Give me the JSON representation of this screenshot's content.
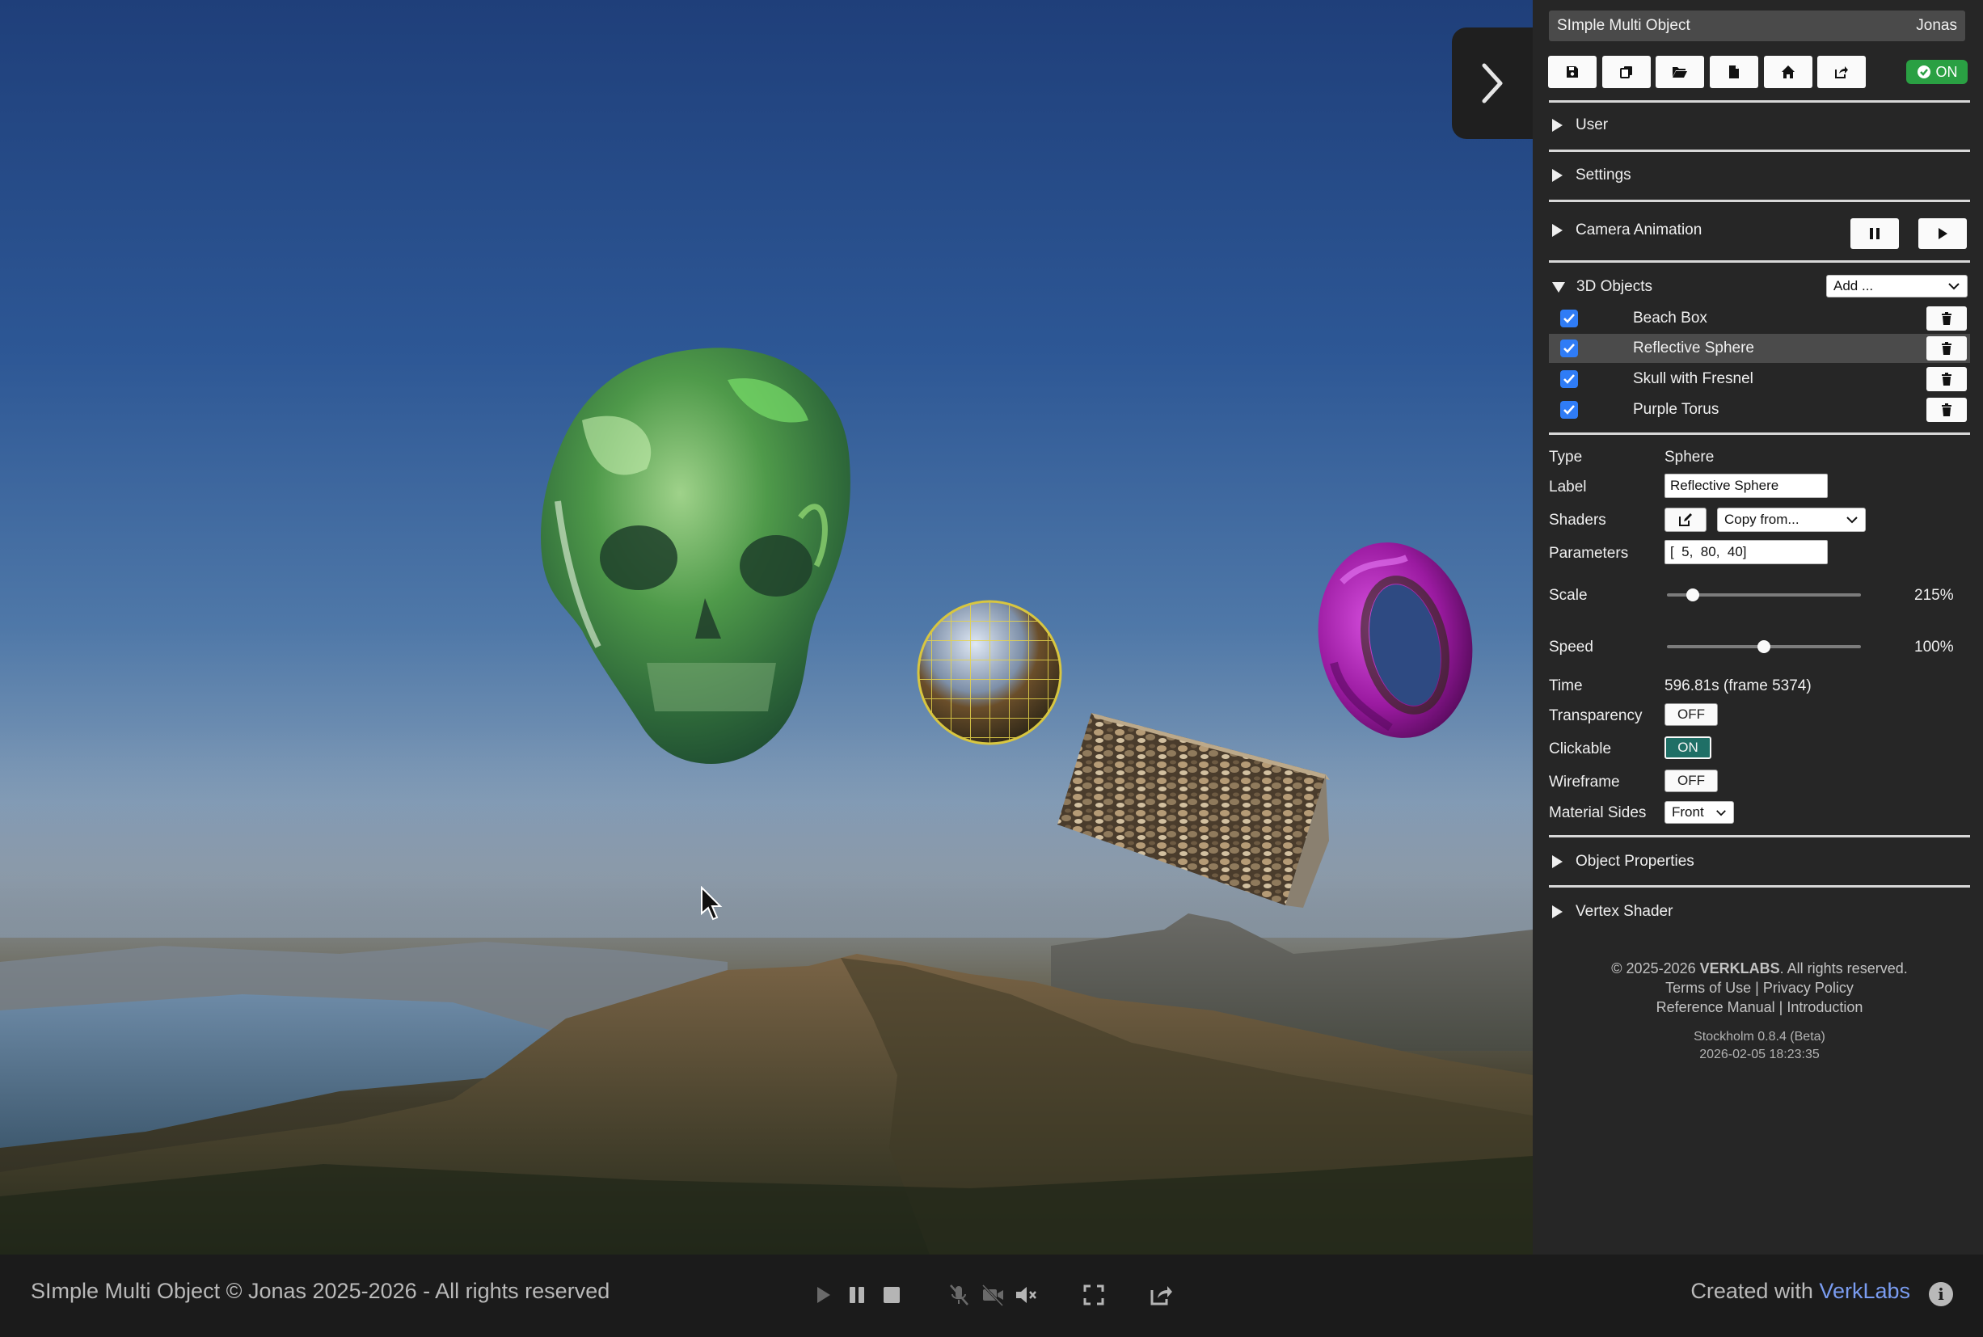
{
  "viewport": {
    "objects": [
      "skull",
      "reflective-sphere",
      "beach-box",
      "purple-torus"
    ]
  },
  "bottom_bar": {
    "title": "SImple Multi Object © Jonas 2025-2026 - All rights reserved",
    "created_prefix": "Created with ",
    "created_brand": "VerkLabs",
    "icons": [
      "play-icon",
      "pause-icon",
      "stop-icon",
      "mic-muted-icon",
      "camera-muted-icon",
      "volume-muted-icon",
      "fullscreen-icon",
      "share-icon",
      "info-icon"
    ]
  },
  "panel": {
    "title": "SImple Multi Object",
    "user": "Jonas",
    "toolbar_icons": [
      "save-icon",
      "copy-icon",
      "open-folder-icon",
      "new-file-icon",
      "home-icon",
      "share-icon"
    ],
    "status": "ON",
    "sections": {
      "user": "User",
      "settings": "Settings",
      "camera_animation": "Camera Animation",
      "objects": "3D Objects",
      "object_properties": "Object Properties",
      "vertex_shader": "Vertex Shader"
    },
    "add_select": "Add ...",
    "objects": [
      {
        "label": "Beach Box",
        "checked": true,
        "selected": false
      },
      {
        "label": "Reflective Sphere",
        "checked": true,
        "selected": true
      },
      {
        "label": "Skull with Fresnel",
        "checked": true,
        "selected": false
      },
      {
        "label": "Purple Torus",
        "checked": true,
        "selected": false
      }
    ],
    "props": {
      "type_label": "Type",
      "type_value": "Sphere",
      "label_label": "Label",
      "label_value": "Reflective Sphere",
      "shaders_label": "Shaders",
      "copy_from": "Copy from...",
      "parameters_label": "Parameters",
      "parameters_value": "[  5,  80,  40]",
      "scale_label": "Scale",
      "scale_value": "215%",
      "scale_fraction": 0.13,
      "speed_label": "Speed",
      "speed_value": "100%",
      "speed_fraction": 0.5,
      "time_label": "Time",
      "time_value": "596.81s (frame 5374)",
      "transparency_label": "Transparency",
      "transparency_value": "OFF",
      "clickable_label": "Clickable",
      "clickable_value": "ON",
      "wireframe_label": "Wireframe",
      "wireframe_value": "OFF",
      "material_sides_label": "Material Sides",
      "material_sides_value": "Front"
    },
    "footer": {
      "copyright_prefix": "© 2025-2026 ",
      "copyright_brand": "VERKLABS",
      "copyright_suffix": ". All rights reserved.",
      "terms": "Terms of Use",
      "privacy": "Privacy Policy",
      "manual": "Reference Manual",
      "intro": "Introduction",
      "version": "Stockholm 0.8.4 (Beta)",
      "build_date": "2026-02-05 18:23:35"
    }
  },
  "colors": {
    "accent_link": "#7a9cf0",
    "status_green": "#2aa043",
    "checkbox_blue": "#2f7cf6",
    "toggle_on": "#1f6f66",
    "torus": "#a020a8"
  }
}
